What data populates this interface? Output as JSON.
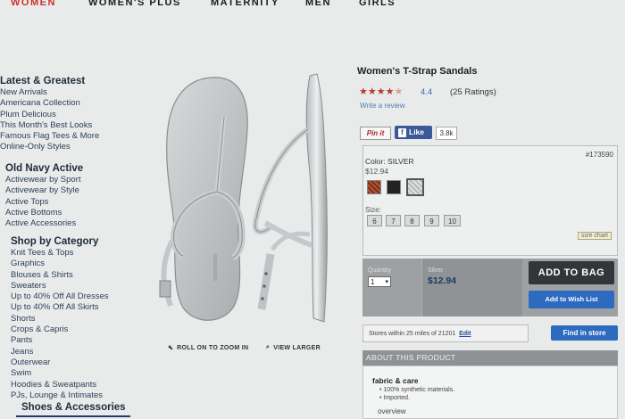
{
  "top_nav": [
    "WOMEN",
    "WOMEN'S PLUS",
    "MATERNITY",
    "MEN",
    "GIRLS"
  ],
  "sidebar": {
    "latest": {
      "title": "Latest & Greatest",
      "items": [
        "New Arrivals",
        "Americana Collection",
        "Plum Delicious",
        "This Month's Best Looks",
        "Famous Flag Tees & More",
        "Online-Only Styles"
      ]
    },
    "active": {
      "title": "Old Navy Active",
      "items": [
        "Activewear by Sport",
        "Activewear by Style",
        "Active Tops",
        "Active Bottoms",
        "Active Accessories"
      ]
    },
    "category": {
      "title": "Shop by Category",
      "items": [
        "Knit Tees & Tops",
        "Graphics",
        "Blouses & Shirts",
        "Sweaters",
        "Up to 40% Off All Dresses",
        "Up to 40% Off All Skirts",
        "Shorts",
        "Crops & Capris",
        "Pants",
        "Jeans",
        "Outerwear",
        "Swim",
        "Hoodies & Sweatpants",
        "PJs, Lounge & Intimates"
      ]
    },
    "shoes_title": "Shoes & Accessories"
  },
  "image_tools": {
    "roll_zoom": "ROLL ON TO ZOOM IN",
    "view_larger": "VIEW LARGER"
  },
  "product": {
    "title": "Women's T-Strap Sandals",
    "rating": "4.4",
    "rating_stars": 4.4,
    "ratings_count": "(25 Ratings)",
    "write_review": "Write a review",
    "pinit": "Pin it",
    "fb_like": "Like",
    "fb_count": "3.8k",
    "item_number": "#173590",
    "color_label": "Color: SILVER",
    "color_price": "$12.94",
    "swatches": [
      "#8a3c2a",
      "#222222",
      "#c8ccd0"
    ],
    "size_label": "Size:",
    "sizes": [
      "6",
      "7",
      "8",
      "9",
      "10"
    ],
    "size_chart": "size chart",
    "quantity_label": "Quantity",
    "quantity_value": "1",
    "price_label": "Silver",
    "price_value": "$12.94",
    "add_to_bag": "ADD TO BAG",
    "add_wish": "Add to Wish List",
    "stores_text": "Stores within 25 miles of 21201",
    "stores_edit": "Edit",
    "find_store": "Find in store",
    "about_title": "ABOUT THIS PRODUCT",
    "fabric_title": "fabric & care",
    "fabric_items": [
      "100% synthetic materials.",
      "Imported."
    ],
    "overview": "overview"
  }
}
